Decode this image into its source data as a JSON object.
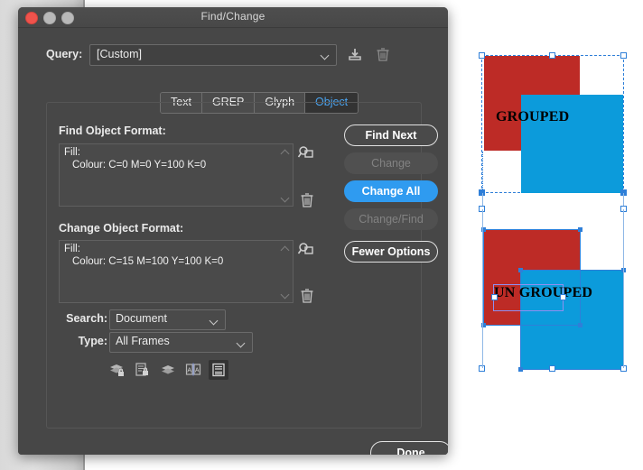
{
  "window": {
    "title": "Find/Change",
    "traffic_lights": [
      "close-button",
      "minimize-button",
      "maximize-button"
    ]
  },
  "query": {
    "label": "Query:",
    "value": "[Custom]",
    "save_icon": "save-query-icon",
    "delete_icon": "delete-query-icon"
  },
  "tabs": [
    {
      "label": "Text",
      "active": false
    },
    {
      "label": "GREP",
      "active": false
    },
    {
      "label": "Glyph",
      "active": false
    },
    {
      "label": "Object",
      "active": true
    }
  ],
  "find_format": {
    "label": "Find Object Format:",
    "line1": "Fill:",
    "line2": "Colour: C=0 M=0 Y=100 K=0",
    "specify_icon": "specify-attributes-icon",
    "clear_icon": "trash-icon"
  },
  "change_format": {
    "label": "Change Object Format:",
    "line1": "Fill:",
    "line2": "Colour: C=15 M=100 Y=100 K=0",
    "specify_icon": "specify-attributes-icon",
    "clear_icon": "trash-icon"
  },
  "actions": {
    "find_next": "Find Next",
    "change": "Change",
    "change_all": "Change All",
    "change_find": "Change/Find",
    "fewer_options": "Fewer Options",
    "done": "Done",
    "primary_color": "#2f9bf0"
  },
  "search": {
    "label": "Search:",
    "value": "Document"
  },
  "type": {
    "label": "Type:",
    "value": "All Frames"
  },
  "toggles": [
    {
      "name": "include-locked-layers-icon",
      "on": false
    },
    {
      "name": "include-locked-stories-icon",
      "on": false
    },
    {
      "name": "include-hidden-layers-icon",
      "on": false
    },
    {
      "name": "include-master-pages-icon",
      "on": false
    },
    {
      "name": "include-footnotes-icon",
      "on": true
    }
  ],
  "document": {
    "colors": {
      "red": "#bd2b26",
      "blue": "#0c9bdb",
      "selection": "#2f7fd8"
    },
    "objects": [
      {
        "label": "GROUPED",
        "selection": "group"
      },
      {
        "label": "UN GROUPED",
        "selection": "ungrouped"
      }
    ]
  }
}
